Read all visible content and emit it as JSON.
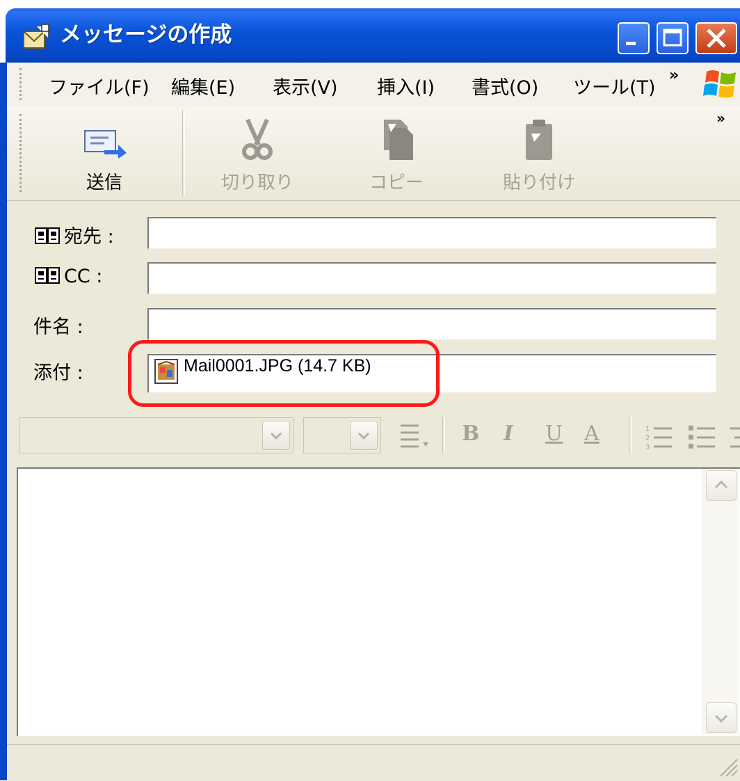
{
  "window": {
    "title": "メッセージの作成"
  },
  "menubar": {
    "items": [
      "ファイル(F)",
      "編集(E)",
      "表示(V)",
      "挿入(I)",
      "書式(O)",
      "ツール(T)"
    ],
    "overflow_chevron": "»"
  },
  "toolbar": {
    "send_label": "送信",
    "cut_label": "切り取り",
    "copy_label": "コピー",
    "paste_label": "貼り付け",
    "overflow_chevron": "»"
  },
  "fields": {
    "to_label": "宛先 :",
    "cc_label": "CC :",
    "subject_label": "件名 :",
    "attach_label": "添付 :",
    "to_value": "",
    "cc_value": "",
    "subject_value": "",
    "attachment": "Mail0001.JPG (14.7 KB)"
  },
  "format_bar": {
    "font_name": "",
    "font_size": "",
    "bold": "B",
    "italic": "I",
    "underline": "U",
    "color": "A"
  },
  "body": {
    "text": ""
  },
  "colors": {
    "titlebar": "#0a55d8",
    "highlight": "#ff1a1a",
    "chrome": "#ece9d8"
  }
}
